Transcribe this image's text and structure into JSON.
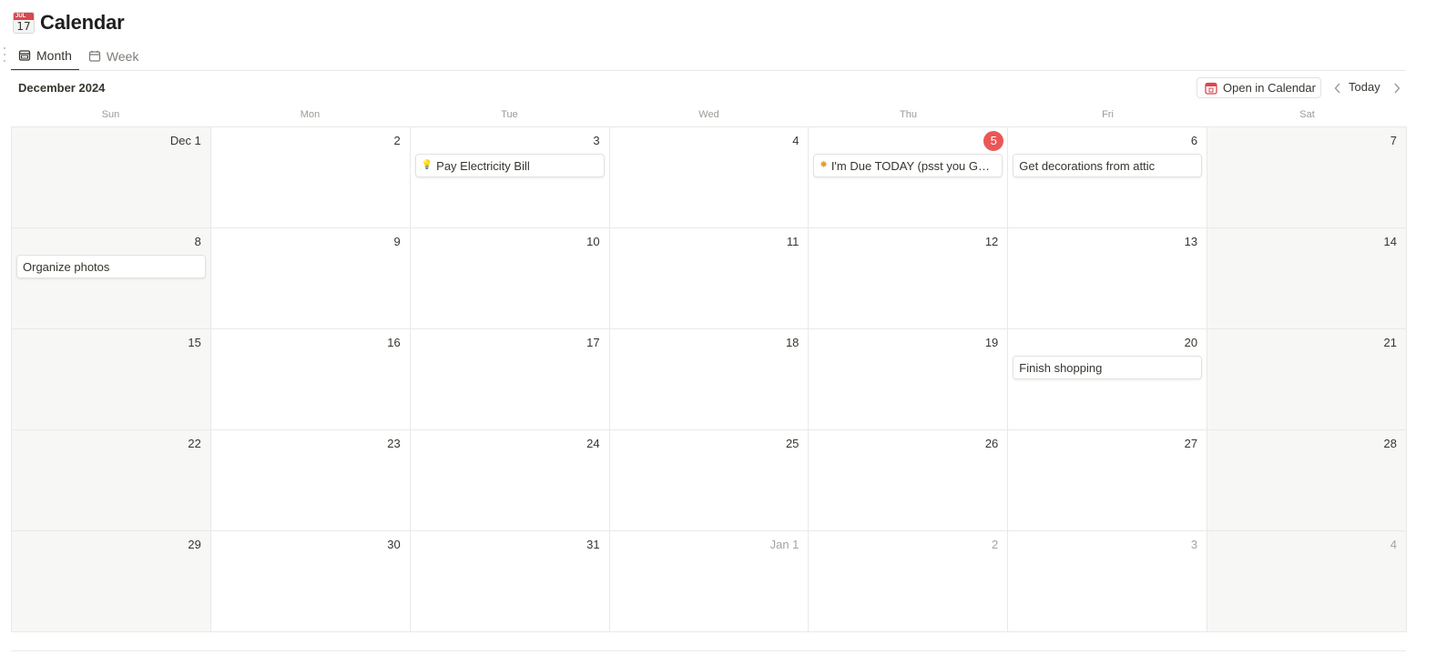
{
  "page": {
    "title": "Calendar",
    "emoji_month": "JUL",
    "emoji_day": "17"
  },
  "tabs": [
    {
      "label": "Month",
      "active": true
    },
    {
      "label": "Week",
      "active": false
    }
  ],
  "toolbar": {
    "month_label": "December 2024",
    "open_in_calendar": "Open in Calendar",
    "today": "Today"
  },
  "weekdays": [
    "Sun",
    "Mon",
    "Tue",
    "Wed",
    "Thu",
    "Fri",
    "Sat"
  ],
  "weeks": [
    [
      {
        "date": "Dec 1"
      },
      {
        "date": "2"
      },
      {
        "date": "3",
        "event": {
          "title": "Pay Electricity Bill",
          "icon": "lightbulb-icon",
          "glyph": "💡"
        }
      },
      {
        "date": "4"
      },
      {
        "date": "5",
        "today": true,
        "event": {
          "title": "I'm Due TODAY (psst you GOT this!)",
          "icon": "sparkle-icon",
          "glyph": "✸"
        }
      },
      {
        "date": "6",
        "event": {
          "title": "Get decorations from attic"
        }
      },
      {
        "date": "7"
      }
    ],
    [
      {
        "date": "8",
        "event": {
          "title": "Organize photos"
        }
      },
      {
        "date": "9"
      },
      {
        "date": "10"
      },
      {
        "date": "11"
      },
      {
        "date": "12"
      },
      {
        "date": "13"
      },
      {
        "date": "14"
      }
    ],
    [
      {
        "date": "15"
      },
      {
        "date": "16"
      },
      {
        "date": "17"
      },
      {
        "date": "18"
      },
      {
        "date": "19"
      },
      {
        "date": "20",
        "event": {
          "title": "Finish shopping"
        }
      },
      {
        "date": "21"
      }
    ],
    [
      {
        "date": "22"
      },
      {
        "date": "23"
      },
      {
        "date": "24"
      },
      {
        "date": "25"
      },
      {
        "date": "26"
      },
      {
        "date": "27"
      },
      {
        "date": "28"
      }
    ],
    [
      {
        "date": "29"
      },
      {
        "date": "30"
      },
      {
        "date": "31"
      },
      {
        "date": "Jan 1",
        "muted": true
      },
      {
        "date": "2",
        "muted": true
      },
      {
        "date": "3",
        "muted": true
      },
      {
        "date": "4",
        "muted": true
      }
    ]
  ],
  "colors": {
    "today_badge": "#eb5757",
    "weekend_bg": "#f7f7f5",
    "calendar_icon_red": "#d9474f"
  }
}
